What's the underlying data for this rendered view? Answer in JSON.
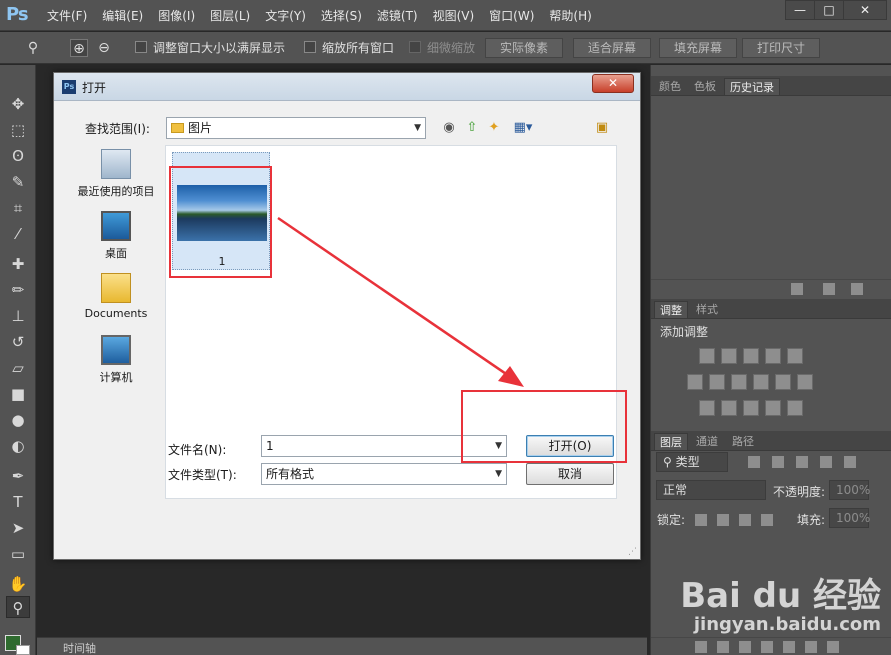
{
  "app": {
    "logo": "Ps",
    "menus": [
      "文件(F)",
      "编辑(E)",
      "图像(I)",
      "图层(L)",
      "文字(Y)",
      "选择(S)",
      "滤镜(T)",
      "视图(V)",
      "窗口(W)",
      "帮助(H)"
    ],
    "window_controls": [
      "—",
      "□",
      "✕"
    ]
  },
  "options_bar": {
    "resize_windows": "调整窗口大小以满屏显示",
    "zoom_all": "缩放所有窗口",
    "scrubby_zoom": "细微缩放",
    "actual_pixels": "实际像素",
    "fit_screen": "适合屏幕",
    "fill_screen": "填充屏幕",
    "print_size": "打印尺寸"
  },
  "timeline": {
    "label": "时间轴"
  },
  "panels": {
    "top_tabs": [
      "颜色",
      "色板",
      "历史记录"
    ],
    "adjust_tabs": [
      "调整",
      "样式"
    ],
    "adjust_title": "添加调整",
    "layers_tabs": [
      "图层",
      "通道",
      "路径"
    ],
    "filter_kind": "类型",
    "blend_mode": "正常",
    "opacity_label": "不透明度:",
    "opacity_value": "100%",
    "lock_label": "锁定:",
    "fill_label": "填充:",
    "fill_value": "100%"
  },
  "dialog": {
    "title": "打开",
    "look_in_label": "查找范围(I):",
    "look_in_value": "图片",
    "places": [
      "最近使用的项目",
      "桌面",
      "Documents",
      "计算机"
    ],
    "files": [
      {
        "name": "1"
      }
    ],
    "filename_label": "文件名(N):",
    "filename_value": "1",
    "filetype_label": "文件类型(T):",
    "filetype_value": "所有格式",
    "open_button": "打开(O)",
    "cancel_button": "取消"
  },
  "watermark": {
    "brand": "Bai du 经验",
    "url": "jingyan.baidu.com"
  },
  "colors": {
    "annotation_red": "#e8323a",
    "ui_gray": "#535353",
    "canvas_dark": "#282828"
  }
}
